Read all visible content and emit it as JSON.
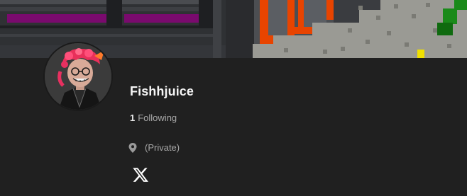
{
  "profile": {
    "username": "Fishhjuice",
    "following_count": "1",
    "following_label": "Following",
    "location": "(Private)"
  },
  "icons": {
    "location": "map-pin-icon",
    "social": "x-logo-icon"
  },
  "colors": {
    "background": "#202020",
    "username": "#f5f5f5",
    "secondary_text": "#a8a8a8",
    "banner_accent_orange": "#e84400",
    "banner_accent_magenta": "#7a0a6e",
    "banner_accent_green": "#1a8a1a",
    "banner_accent_yellow": "#f0e000"
  }
}
